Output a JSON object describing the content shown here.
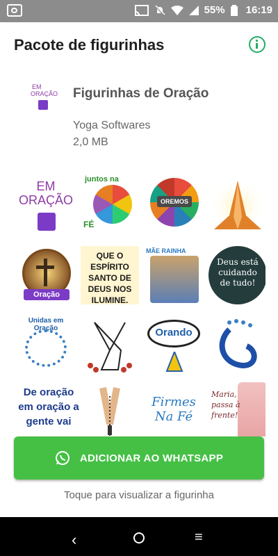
{
  "status": {
    "battery": "55%",
    "time": "16:19"
  },
  "appbar": {
    "title": "Pacote de figurinhas"
  },
  "pack": {
    "tray_text_1": "EM",
    "tray_text_2": "ORAÇÃO",
    "name": "Figurinhas de Oração",
    "publisher": "Yoga Softwares",
    "size": "2,0 MB"
  },
  "stickers": [
    {
      "label": "EM ORAÇÃO"
    },
    {
      "label_top": "juntos na",
      "label_bottom": "FÉ"
    },
    {
      "label": "OREMOS"
    },
    {
      "label": ""
    },
    {
      "label": "Oração"
    },
    {
      "label": "QUE O ESPÍRITO SANTO DE DEUS NOS ILUMINE."
    },
    {
      "label": "MÃE RAINHA"
    },
    {
      "label": "Deus está cuidando de tudo!"
    },
    {
      "label": "Unidas em Oração"
    },
    {
      "label": ""
    },
    {
      "label": "Orando"
    },
    {
      "label": ""
    },
    {
      "label": "De oração em oração a gente vai"
    },
    {
      "label": ""
    },
    {
      "label": "Firmes Na Fé"
    },
    {
      "label": "Maria, passa à frente!"
    }
  ],
  "actions": {
    "add_label": "ADICIONAR AO WHATSAPP"
  },
  "hint": "Toque para visualizar a figurinha",
  "colors": {
    "accent": "#45c045",
    "info": "#1fae64"
  }
}
